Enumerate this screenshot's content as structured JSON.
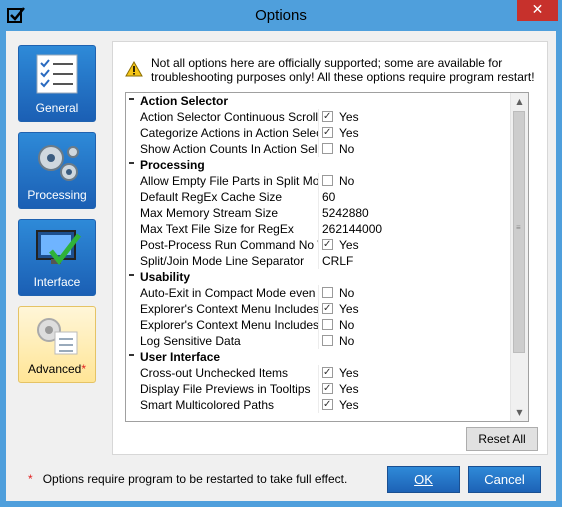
{
  "window": {
    "title": "Options",
    "close_glyph": "✕"
  },
  "sidebar": {
    "items": [
      {
        "label": "General",
        "icon": "checklist-icon",
        "active": false
      },
      {
        "label": "Processing",
        "icon": "gears-icon",
        "active": false
      },
      {
        "label": "Interface",
        "icon": "monitor-check-icon",
        "active": false
      },
      {
        "label": "Advanced",
        "icon": "advanced-gears-icon",
        "active": true,
        "star": "*"
      }
    ]
  },
  "warning": {
    "text": "Not all options here are officially supported; some are available for troubleshooting purposes only! All these options require program restart!"
  },
  "grid": {
    "categories": [
      {
        "name": "Action Selector",
        "rows": [
          {
            "name": "Action Selector Continuous Scroll",
            "type": "bool",
            "checked": true,
            "value": "Yes"
          },
          {
            "name": "Categorize Actions in Action Selecto",
            "type": "bool",
            "checked": true,
            "value": "Yes"
          },
          {
            "name": "Show Action Counts In Action Select",
            "type": "bool",
            "checked": false,
            "value": "No"
          }
        ]
      },
      {
        "name": "Processing",
        "rows": [
          {
            "name": "Allow Empty File Parts in Split Mode",
            "type": "bool",
            "checked": false,
            "value": "No"
          },
          {
            "name": "Default RegEx Cache Size",
            "type": "text",
            "value": "60"
          },
          {
            "name": "Max Memory Stream Size",
            "type": "text",
            "value": "5242880"
          },
          {
            "name": "Max Text File Size for RegEx",
            "type": "text",
            "value": "262144000"
          },
          {
            "name": "Post-Process Run Command No Wi",
            "type": "bool",
            "checked": true,
            "value": "Yes"
          },
          {
            "name": "Split/Join Mode Line Separator",
            "type": "text",
            "value": "CRLF"
          }
        ]
      },
      {
        "name": "Usability",
        "rows": [
          {
            "name": "Auto-Exit in Compact Mode even if",
            "type": "bool",
            "checked": false,
            "value": "No"
          },
          {
            "name": "Explorer's Context Menu Includes F",
            "type": "bool",
            "checked": true,
            "value": "Yes"
          },
          {
            "name": "Explorer's Context Menu Includes F",
            "type": "bool",
            "checked": false,
            "value": "No"
          },
          {
            "name": "Log Sensitive Data",
            "type": "bool",
            "checked": false,
            "value": "No"
          }
        ]
      },
      {
        "name": "User Interface",
        "rows": [
          {
            "name": "Cross-out Unchecked Items",
            "type": "bool",
            "checked": true,
            "value": "Yes"
          },
          {
            "name": "Display File Previews in Tooltips",
            "type": "bool",
            "checked": true,
            "value": "Yes"
          },
          {
            "name": "Smart Multicolored Paths",
            "type": "bool",
            "checked": true,
            "value": "Yes"
          }
        ]
      }
    ]
  },
  "buttons": {
    "reset": "Reset All",
    "ok": "OK",
    "cancel": "Cancel"
  },
  "footer": {
    "star": "*",
    "note": "Options require program to be restarted to take full effect."
  },
  "colors": {
    "chrome": "#4f9fdc",
    "close": "#c7312c",
    "accent": "#1d62b6",
    "active_tab": "#ffe596"
  }
}
